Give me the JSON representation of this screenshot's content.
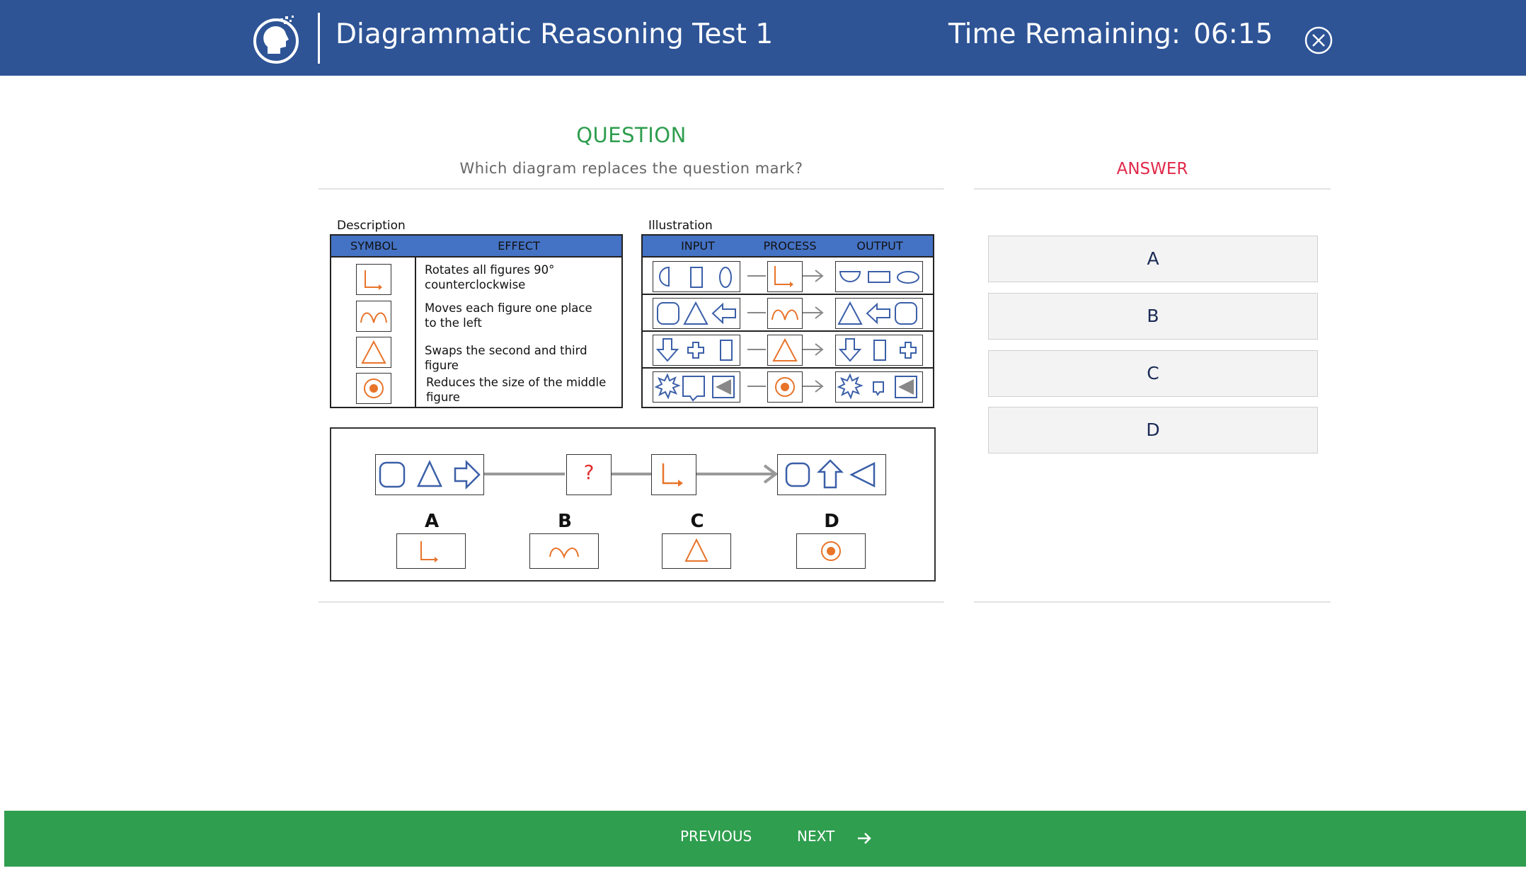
{
  "header": {
    "title": "Diagrammatic Reasoning Test 1",
    "timer_label": "Time Remaining:",
    "timer_value": "06:15",
    "logo_icon": "brain-head-logo-icon",
    "close_icon": "close-circle-icon",
    "background_color": "#2e5496"
  },
  "question": {
    "heading": "QUESTION",
    "prompt": "Which diagram replaces the question mark?",
    "heading_color": "#2f9e4f"
  },
  "description": {
    "caption": "Description",
    "headers": [
      "SYMBOL",
      "EFFECT"
    ],
    "rows": [
      {
        "symbol": "rotate-corner-arrow-icon",
        "effect_lines": [
          "Rotates all figures 90°",
          "counterclockwise"
        ]
      },
      {
        "symbol": "double-arch-icon",
        "effect_lines": [
          "Moves each figure one place",
          "to the left"
        ]
      },
      {
        "symbol": "triangle-icon",
        "effect_lines": [
          "Swaps the second and third figure"
        ]
      },
      {
        "symbol": "target-dot-icon",
        "effect_lines": [
          "Reduces the size of the middle",
          "figure"
        ]
      }
    ]
  },
  "illustration": {
    "caption": "Illustration",
    "headers": [
      "INPUT",
      "PROCESS",
      "OUTPUT"
    ]
  },
  "puzzle": {
    "question_mark": "?",
    "options": [
      "A",
      "B",
      "C",
      "D"
    ]
  },
  "answer": {
    "heading": "ANSWER",
    "heading_color": "#e0294a",
    "choices": [
      "A",
      "B",
      "C",
      "D"
    ]
  },
  "footer": {
    "previous_label": "PREVIOUS",
    "next_label": "NEXT",
    "next_icon": "arrow-right-icon",
    "background_color": "#2f9e4f"
  },
  "colors": {
    "shape_blue": "#3b5fa8",
    "symbol_orange": "#e8742a",
    "table_header": "#4472c4"
  }
}
